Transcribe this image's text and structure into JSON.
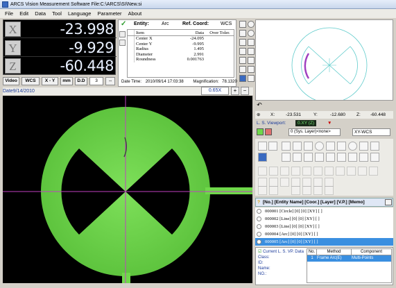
{
  "app": {
    "title": "ARCS Vision Measurement Software    File:C:\\ARCS\\SI\\New.si"
  },
  "menu": [
    "File",
    "Edit",
    "Data",
    "Tool",
    "Language",
    "Parameter",
    "About"
  ],
  "dro": {
    "axes": [
      {
        "label": "X",
        "value": "-23.998"
      },
      {
        "label": "Y",
        "value": "-9.929"
      },
      {
        "label": "Z",
        "value": "-60.448"
      }
    ]
  },
  "entity": {
    "label": "Entity:",
    "type": "Arc",
    "ref_label": "Ref. Coord:",
    "ref": "WCS",
    "headers": [
      "Item",
      "Data",
      "Over Toler."
    ],
    "rows": [
      {
        "item": "Center X",
        "data": "-24.095"
      },
      {
        "item": "Center Y",
        "data": "-9.995"
      },
      {
        "item": "Radius",
        "data": "1.495"
      },
      {
        "item": "Diameter",
        "data": "2.991"
      },
      {
        "item": "Roundness",
        "data": "0.001763"
      }
    ],
    "datetime_label": "Date Time:",
    "datetime": "2010/09/14 17:03:38",
    "mag_label": "Magnification:",
    "mag": "78.1320"
  },
  "video_toolbar": {
    "video": "Video",
    "wcs": "WCS",
    "xy": "X - Y",
    "mm": "mm",
    "dd": "D.D",
    "dd_val": "3"
  },
  "date_label": "Date9/14/2010",
  "zoom": "0.65X",
  "coords": {
    "x_label": "X:",
    "x": "-23.531",
    "y_label": "Y:",
    "y": "-12.680",
    "z_label": "Z:",
    "z": "-60.448"
  },
  "viewport": {
    "label": "L. S. Viewport:",
    "value": "0.XY (Z)"
  },
  "layer": {
    "value": "0 (Sys. Layer)<none>",
    "wcs": "XY-WCS"
  },
  "list_header": "[No.] [Entity Name] [Coor.] [Layer] [V.P.] [Memo]",
  "list": [
    "000001 [Circle] [0] [0] [XY] [ ]",
    "000002 [Line] [0] [0] [XY] [ ]",
    "000003 [Line] [0] [0] [XY] [ ]",
    "000004 [Arc] [0] [0] [XY] [ ]",
    "000005 [Arc] [0] [0] [XY] [ ]"
  ],
  "bottom": {
    "current": "Current L. S. VP. Data",
    "fields": [
      "Class:",
      "ID:",
      "Name:",
      "NO.:"
    ],
    "headers": [
      "No.",
      "Method",
      "Component"
    ],
    "row": {
      "no": "1",
      "method": "Frame Arc(E)",
      "component": "Multi-Points"
    }
  },
  "colors": {
    "dro_bg": "#000000",
    "accent_green": "#6fd84a",
    "crosshair": "#c040c0",
    "selected": "#3a8fe0"
  }
}
